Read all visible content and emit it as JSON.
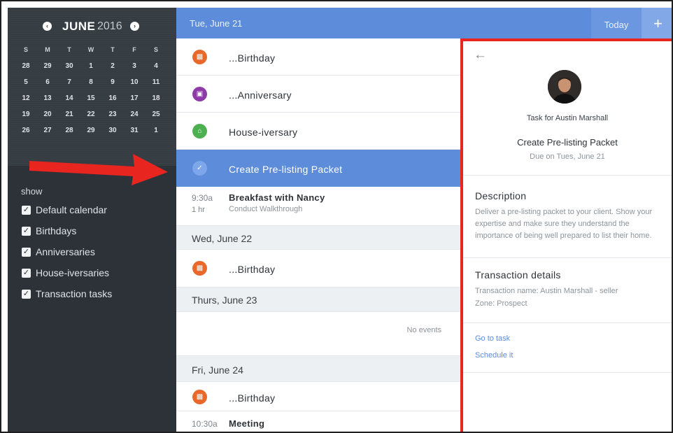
{
  "calendar": {
    "month": "JUNE",
    "year": "2016",
    "weekdays": [
      "S",
      "M",
      "T",
      "W",
      "T",
      "F",
      "S"
    ],
    "weeks": [
      [
        "28",
        "29",
        "30",
        "1",
        "2",
        "3",
        "4"
      ],
      [
        "5",
        "6",
        "7",
        "8",
        "9",
        "10",
        "11"
      ],
      [
        "12",
        "13",
        "14",
        "15",
        "16",
        "17",
        "18"
      ],
      [
        "19",
        "20",
        "21",
        "22",
        "23",
        "24",
        "25"
      ],
      [
        "26",
        "27",
        "28",
        "29",
        "30",
        "31",
        "1"
      ]
    ]
  },
  "filters": {
    "label": "show",
    "items": [
      "Default calendar",
      "Birthdays",
      "Anniversaries",
      "House-iversaries",
      "Transaction tasks"
    ]
  },
  "header": {
    "date": "Tue, June 21",
    "today_label": "Today",
    "add_label": "+"
  },
  "agenda": {
    "birthday_1": "...Birthday",
    "anniversary": "...Anniversary",
    "houseiversary": "House-iversary",
    "selected_task": "Create Pre-listing Packet",
    "meeting_time": "9:30a",
    "meeting_duration": "1 hr",
    "meeting_title": "Breakfast with Nancy",
    "meeting_sub": "Conduct Walkthrough",
    "day_2": "Wed, June 22",
    "birthday_2": "...Birthday",
    "day_3": "Thurs, June 23",
    "no_events": "No events",
    "day_4": "Fri, June 24",
    "birthday_3": "...Birthday",
    "meeting2_time": "10:30a",
    "meeting2_title": "Meeting"
  },
  "detail": {
    "task_for": "Task for Austin Marshall",
    "title": "Create Pre-listing Packet",
    "due": "Due on Tues, June 21",
    "description_heading": "Description",
    "description_text": "Deliver a pre-listing packet to your client. Show your expertise and make sure they understand the importance of being well prepared to list their home.",
    "transaction_heading": "Transaction details",
    "transaction_name": "Transaction name: Austin Marshall - seller",
    "zone": "Zone: Prospect",
    "go_to_task": "Go to task",
    "schedule_it": "Schedule it"
  },
  "colors": {
    "accent": "#5d8cdb",
    "sidebar": "#2c3238",
    "highlight_border": "#e8251f",
    "birthday_icon": "#e8672b",
    "anniversary_icon": "#8e3aa8",
    "houseiversary_icon": "#4caf50"
  },
  "icons": {
    "prev": "chevron-left-icon",
    "next": "chevron-right-icon",
    "birthday": "cake-icon",
    "anniversary": "gift-icon",
    "houseiversary": "house-icon",
    "task": "checklist-icon",
    "back": "back-arrow-icon",
    "checkbox": "checkbox-checked-icon"
  }
}
